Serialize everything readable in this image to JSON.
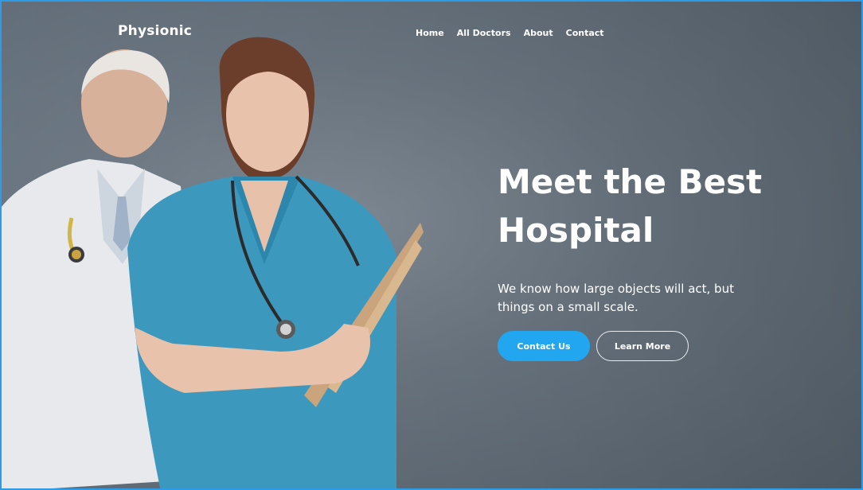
{
  "brand": {
    "logo": "Physionic"
  },
  "nav": {
    "items": [
      {
        "label": "Home"
      },
      {
        "label": "All Doctors"
      },
      {
        "label": "About"
      },
      {
        "label": "Contact"
      }
    ]
  },
  "hero": {
    "headline": "Meet the Best Hospital",
    "subtext": "We know how large objects will act, but things on a small scale.",
    "buttons": {
      "primary": "Contact Us",
      "secondary": "Learn More"
    }
  },
  "colors": {
    "primary": "#23a6f0",
    "text": "#ffffff",
    "background": "#6f7b86"
  }
}
